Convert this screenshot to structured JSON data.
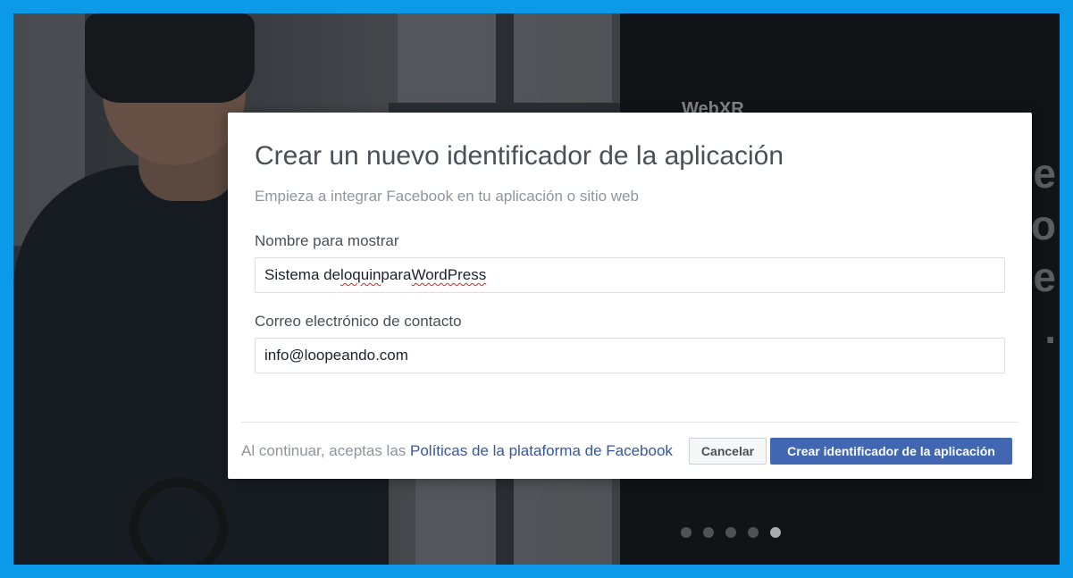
{
  "background": {
    "brand": "WebXR",
    "side_letters": [
      "e",
      "ro",
      "e",
      "."
    ],
    "carousel": {
      "count": 5,
      "active_index": 4
    }
  },
  "dialog": {
    "title": "Crear un nuevo identificador de la aplicación",
    "subtitle": "Empieza a integrar Facebook en tu aplicación o sitio web",
    "fields": [
      {
        "label": "Nombre para mostrar",
        "value_parts": [
          "Sistema de ",
          "loquin",
          " para ",
          "WordPress"
        ]
      },
      {
        "label": "Correo electrónico de contacto",
        "value": "info@loopeando.com"
      }
    ],
    "footer": {
      "prefix": "Al continuar, aceptas las ",
      "link": "Políticas de la plataforma de Facebook"
    },
    "buttons": {
      "cancel": "Cancelar",
      "create": "Crear identificador de la aplicación"
    }
  },
  "colors": {
    "frame_border": "#0c99e8",
    "primary_button": "#4267b2",
    "link": "#365899",
    "spellcheck": "#e0201f"
  }
}
